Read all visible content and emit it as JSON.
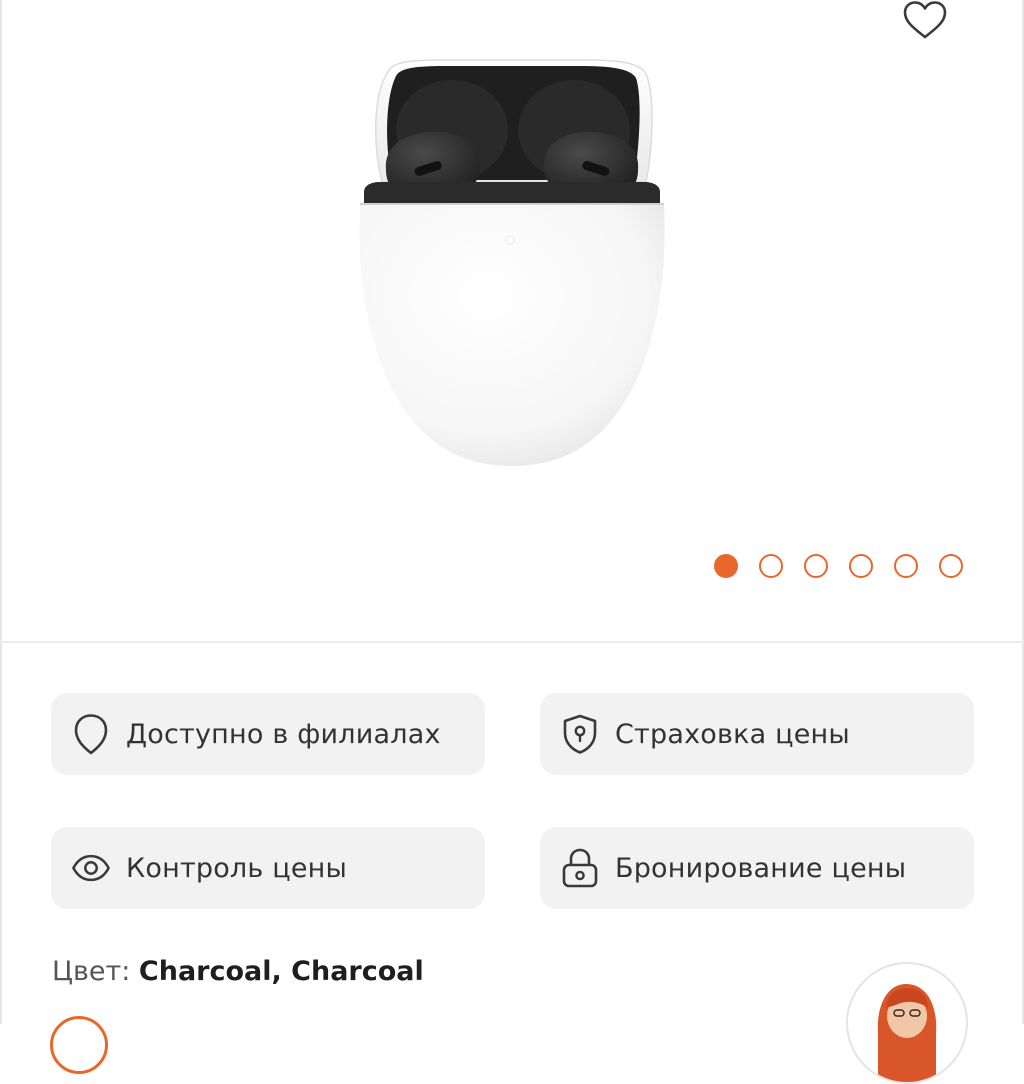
{
  "gallery": {
    "image_alt": "Charcoal",
    "dots": [
      {
        "active": true
      },
      {
        "active": false
      },
      {
        "active": false
      },
      {
        "active": false
      },
      {
        "active": false
      },
      {
        "active": false
      }
    ]
  },
  "features": {
    "availability": {
      "label": "Доступно в филиалах",
      "icon": "map-pin-icon"
    },
    "price_insurance": {
      "label": "Страховка цены",
      "icon": "shield-icon"
    },
    "price_control": {
      "label": "Контроль цены",
      "icon": "eye-icon"
    },
    "price_booking": {
      "label": "Бронирование цены",
      "icon": "lock-icon"
    }
  },
  "product": {
    "color_label": "Цвет:",
    "color_value": "Charcoal, Charcoal"
  },
  "icons": {
    "favorite": "heart-icon",
    "assistant": "assistant-avatar"
  },
  "colors": {
    "accent": "#e9672b",
    "button_bg": "#f2f2f2",
    "text": "#333333"
  }
}
